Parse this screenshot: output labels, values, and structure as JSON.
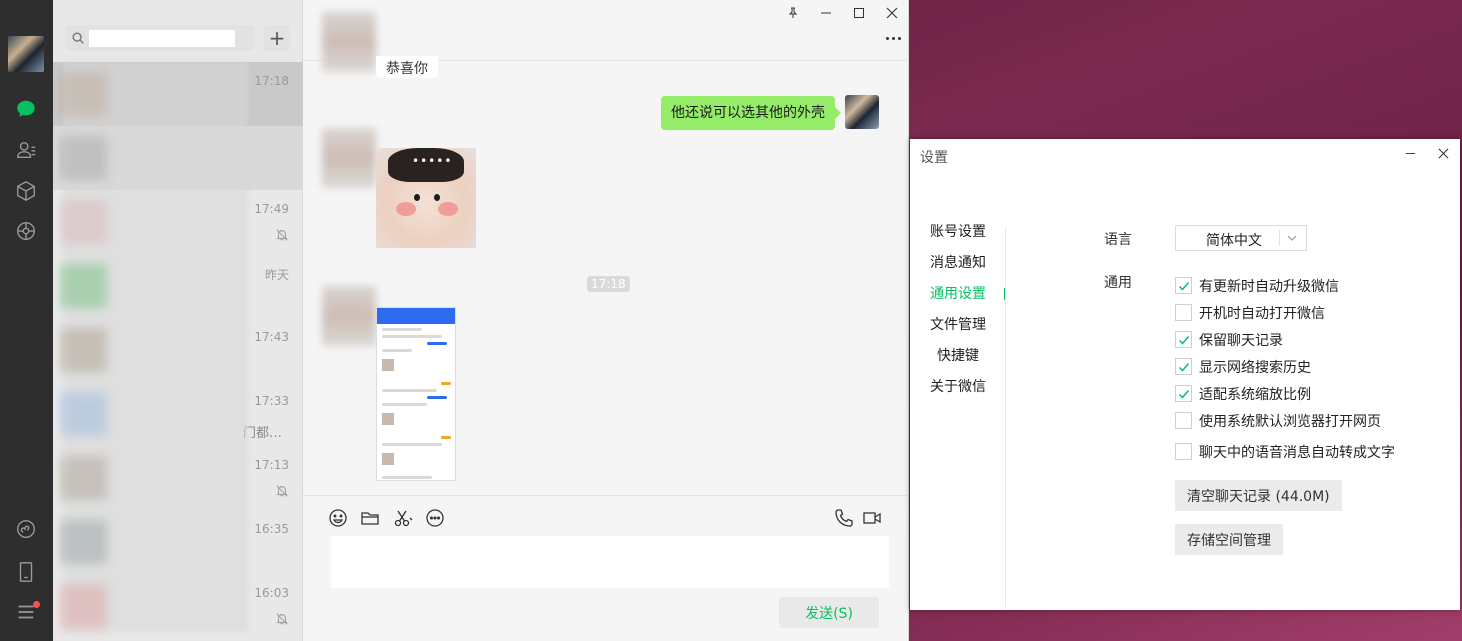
{
  "nav": {
    "icons": [
      "chat-icon",
      "contacts-icon",
      "favorites-icon",
      "moments-icon",
      "mini-program-icon",
      "phone-icon",
      "menu-icon"
    ],
    "accent": "#07c160"
  },
  "chat_list": {
    "search_placeholder": "",
    "items": [
      {
        "time": "17:18",
        "muted": false,
        "preview": ""
      },
      {
        "time": "",
        "muted": false,
        "preview": ""
      },
      {
        "time": "17:49",
        "muted": true,
        "preview": ""
      },
      {
        "time": "昨天",
        "muted": false,
        "preview": ""
      },
      {
        "time": "17:43",
        "muted": false,
        "preview": ""
      },
      {
        "time": "17:33",
        "muted": false,
        "preview": "门都…"
      },
      {
        "time": "17:13",
        "muted": true,
        "preview": ""
      },
      {
        "time": "16:35",
        "muted": false,
        "preview": ""
      },
      {
        "time": "16:03",
        "muted": true,
        "preview": ""
      }
    ]
  },
  "chat": {
    "partial_message": "恭喜你",
    "outgoing_message": "他还说可以选其他的外壳",
    "time_separator": "17:18",
    "sticker_text": "•••••",
    "send_label": "发送(S)",
    "input_value": ""
  },
  "settings": {
    "title": "设置",
    "nav": [
      "账号设置",
      "消息通知",
      "通用设置",
      "文件管理",
      "快捷键",
      "关于微信"
    ],
    "active_nav": "通用设置",
    "language_label": "语言",
    "language_value": "简体中文",
    "general_label": "通用",
    "options": [
      {
        "label": "有更新时自动升级微信",
        "checked": true
      },
      {
        "label": "开机时自动打开微信",
        "checked": false
      },
      {
        "label": "保留聊天记录",
        "checked": true
      },
      {
        "label": "显示网络搜索历史",
        "checked": true
      },
      {
        "label": "适配系统缩放比例",
        "checked": true
      },
      {
        "label": "使用系统默认浏览器打开网页",
        "checked": false
      },
      {
        "label": "聊天中的语音消息自动转成文字",
        "checked": false
      }
    ],
    "clear_button": "清空聊天记录 (44.0M)",
    "storage_button": "存储空间管理"
  }
}
